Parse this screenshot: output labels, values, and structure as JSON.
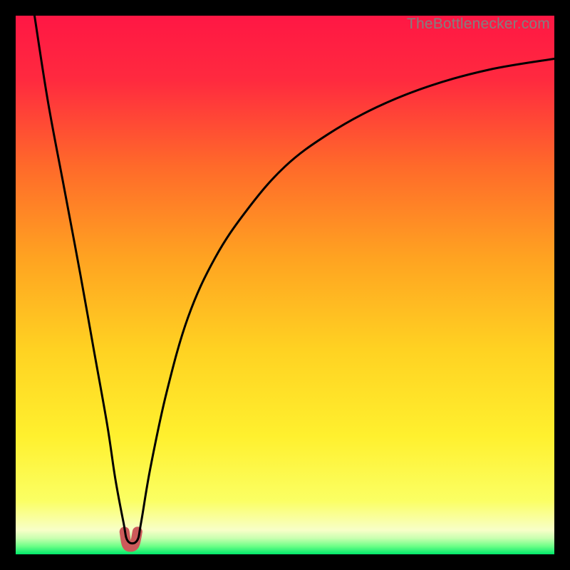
{
  "watermark": "TheBottlenecker.com",
  "chart_data": {
    "type": "line",
    "title": "",
    "xlabel": "",
    "ylabel": "",
    "xlim": [
      0,
      100
    ],
    "ylim": [
      0,
      100
    ],
    "gradient_stops": [
      {
        "pos": 0.0,
        "color": "#ff1744"
      },
      {
        "pos": 0.12,
        "color": "#ff2a3f"
      },
      {
        "pos": 0.28,
        "color": "#ff6a2a"
      },
      {
        "pos": 0.45,
        "color": "#ffa321"
      },
      {
        "pos": 0.62,
        "color": "#ffd222"
      },
      {
        "pos": 0.78,
        "color": "#fff02e"
      },
      {
        "pos": 0.9,
        "color": "#fbff63"
      },
      {
        "pos": 0.955,
        "color": "#f8ffc8"
      },
      {
        "pos": 0.97,
        "color": "#c9ffb0"
      },
      {
        "pos": 0.985,
        "color": "#6dff87"
      },
      {
        "pos": 1.0,
        "color": "#00e86a"
      }
    ],
    "series": [
      {
        "name": "bottleneck-curve",
        "x": [
          3.5,
          6,
          9,
          12,
          14.5,
          17,
          18.5,
          20,
          20.8,
          22.5,
          23.3,
          25,
          28,
          32,
          37,
          43,
          50,
          58,
          67,
          77,
          88,
          100
        ],
        "y": [
          100,
          84,
          68,
          52,
          38,
          24,
          14,
          6,
          2.5,
          2.5,
          6,
          16,
          30,
          44,
          55,
          64,
          72,
          78,
          83,
          87,
          90,
          92
        ]
      }
    ],
    "marker": {
      "name": "dip-marker",
      "color": "#cc5a5a",
      "stroke_width": 14,
      "points_x": [
        20.2,
        20.6,
        21.3,
        22.1,
        22.6
      ],
      "points_y": [
        4.2,
        1.9,
        1.4,
        1.9,
        4.2
      ]
    }
  }
}
